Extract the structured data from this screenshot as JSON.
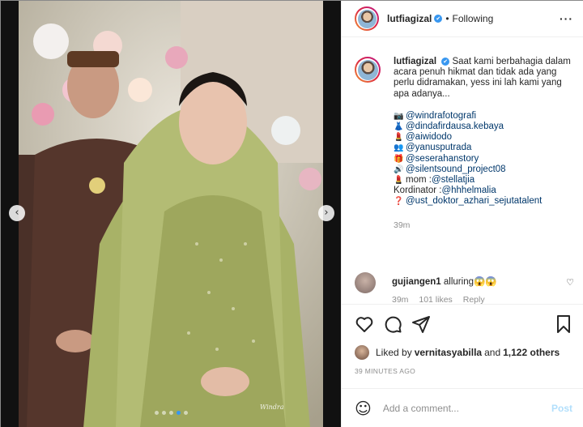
{
  "post": {
    "username": "lutfiagizal",
    "verified_mark": "✔",
    "separator": "•",
    "follow_status": "Following",
    "more_glyph": "···"
  },
  "caption": {
    "username": "lutfiagizal",
    "text": "Saat kami berbahagia dalam acara penuh hikmat dan tidak ada yang perlu didramakan, yess ini lah kami yang apa adanya...",
    "credits": [
      {
        "emoji": "📷",
        "text": "@windrafotografi",
        "is_link": true
      },
      {
        "emoji": "👗",
        "text": "@dindafirdausa.kebaya",
        "is_link": true
      },
      {
        "emoji": "💄",
        "text": "@aiwidodo",
        "is_link": true
      },
      {
        "emoji": "👥",
        "text": "@yanusputrada",
        "is_link": true
      },
      {
        "emoji": "🎁",
        "text": "@seserahanstory",
        "is_link": true
      },
      {
        "emoji": "🔊",
        "text": "@silentsound_project08",
        "is_link": true
      },
      {
        "emoji": "💄",
        "text": "mom : ",
        "link": "@stellatjia"
      },
      {
        "emoji": "",
        "text": "Kordinator : ",
        "link": "@hhhelmalia"
      },
      {
        "emoji": "❓",
        "text": "@ust_doktor_azhari_sejutatalent",
        "is_link": true
      }
    ],
    "time": "39m"
  },
  "comment": {
    "username": "gujiangen1",
    "text": "alluring😱😱",
    "time": "39m",
    "likes": "101 likes",
    "reply": "Reply"
  },
  "likes": {
    "prefix": "Liked by ",
    "user": "vernitasyabilla",
    "middle": " and ",
    "count": "1,122 others"
  },
  "posted_ago": "39 MINUTES AGO",
  "add_comment": {
    "placeholder": "Add a comment...",
    "post_label": "Post"
  },
  "media": {
    "watermark": "Windra"
  },
  "colors": {
    "link": "#00376b",
    "verified": "#3897f0",
    "muted": "#8e8e8e",
    "post_disabled": "#b2dffc"
  }
}
